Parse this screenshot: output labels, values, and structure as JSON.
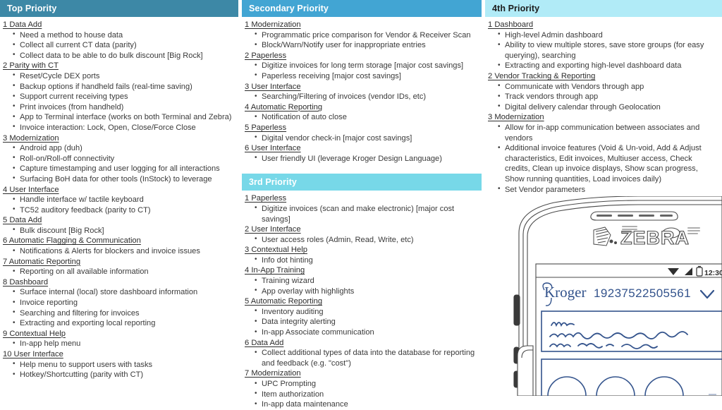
{
  "columns": [
    {
      "id": "top-priority",
      "sections": [
        {
          "band": {
            "label": "Top Priority",
            "bg": "#3d88a6",
            "text_color": "#ffffff"
          },
          "groups": [
            {
              "title": "1 Data Add",
              "items": [
                "Need a method to house data",
                "Collect all current CT data (parity)",
                "Collect data to be able to do bulk discount [Big Rock]"
              ]
            },
            {
              "title": "2 Parity with CT",
              "items": [
                "Reset/Cycle DEX ports",
                "Backup options if handheld fails (real-time saving)",
                "Support current receiving types",
                "Print invoices (from handheld)",
                "App to Terminal interface (works on both Terminal and Zebra)",
                "Invoice interaction: Lock, Open, Close/Force Close"
              ]
            },
            {
              "title": "3 Modernization",
              "items": [
                "Android app (duh)",
                "Roll-on/Roll-off connectivity",
                "Capture timestamping and user logging for all interactions",
                "Surfacing BoH data for other tools (InStock) to leverage"
              ]
            },
            {
              "title": "4 User Interface",
              "items": [
                "Handle interface w/ tactile keyboard",
                "TC52 auditory feedback (parity to CT)"
              ]
            },
            {
              "title": "5 Data Add",
              "items": [
                "Bulk discount [Big Rock]"
              ]
            },
            {
              "title": "6 Automatic Flagging & Communication",
              "items": [
                "Notifications & Alerts for blockers and invoice issues"
              ]
            },
            {
              "title": "7 Automatic Reporting",
              "items": [
                "Reporting on all available information"
              ]
            },
            {
              "title": "8 Dashboard",
              "items": [
                "Surface internal (local) store dashboard information",
                "Invoice reporting",
                "Searching and filtering for invoices",
                "Extracting and exporting local reporting"
              ]
            },
            {
              "title": "9 Contextual Help",
              "items": [
                "In-app help menu"
              ]
            },
            {
              "title": "10 User Interface",
              "items": [
                "Help menu to support users with tasks",
                "Hotkey/Shortcutting (parity with CT)"
              ]
            }
          ]
        }
      ]
    },
    {
      "id": "secondary-and-third-priority",
      "sections": [
        {
          "band": {
            "label": "Secondary Priority",
            "bg": "#42a5d3",
            "text_color": "#ffffff"
          },
          "groups": [
            {
              "title": "1 Modernization",
              "items": [
                "Programmatic price comparison for Vendor & Receiver Scan",
                "Block/Warn/Notify user for inappropriate entries"
              ]
            },
            {
              "title": "2 Paperless",
              "items": [
                "Digitize invoices for long term storage [major cost savings]",
                "Paperless receiving [major cost savings]"
              ]
            },
            {
              "title": "3 User Interface",
              "items": [
                "Searching/Filtering of invoices (vendor IDs, etc)"
              ]
            },
            {
              "title": "4 Automatic Reporting",
              "items": [
                "Notification of auto close"
              ]
            },
            {
              "title": "5 Paperless",
              "items": [
                "Digital vendor check-in [major cost savings]"
              ]
            },
            {
              "title": "6 User Interface",
              "items": [
                "User friendly UI (leverage Kroger Design Language)"
              ]
            }
          ]
        },
        {
          "band": {
            "label": "3rd Priority",
            "bg": "#77d8e8",
            "text_color": "#ffffff"
          },
          "groups": [
            {
              "title": "1 Paperless",
              "items": [
                "Digitize invoices (scan and make electronic) [major cost savings]"
              ]
            },
            {
              "title": "2 User Interface",
              "items": [
                "User access roles (Admin, Read, Write, etc)"
              ]
            },
            {
              "title": "3 Contextual Help",
              "items": [
                "Info dot hinting"
              ]
            },
            {
              "title": "4 In-App Training",
              "items": [
                "Training wizard",
                "App overlay with highlights"
              ]
            },
            {
              "title": "5 Automatic Reporting",
              "items": [
                "Inventory auditing",
                "Data integrity alerting",
                "In-app Associate communication"
              ]
            },
            {
              "title": "6 Data Add",
              "items": [
                "Collect additional types of data into the database for reporting and feedback (e.g. \"cost\")"
              ]
            },
            {
              "title": "7 Modernization",
              "items": [
                "UPC Prompting",
                "Item authorization",
                "In-app data maintenance"
              ]
            }
          ]
        }
      ]
    },
    {
      "id": "fourth-priority",
      "sections": [
        {
          "band": {
            "label": "4th Priority",
            "bg": "#b1ebf7",
            "text_color": "#1c1c1c"
          },
          "groups": [
            {
              "title": "1 Dashboard",
              "items": [
                "High-level Admin dashboard",
                "Ability to view multiple stores, save store groups (for easy querying), searching",
                "Extracting and exporting high-level dashboard data"
              ]
            },
            {
              "title": "2 Vendor Tracking & Reporting",
              "items": [
                "Communicate with Vendors through app",
                "Track vendors through app",
                "Digital delivery calendar through Geolocation"
              ]
            },
            {
              "title": "3 Modernization",
              "items": [
                "Allow for in-app communication between associates and vendors",
                "Additional invoice features (Void & Un-void, Add & Adjust characteristics, Edit invoices, Multiuser access, Check credits, Clean up invoice displays, Show scan progress, Show running quantities, Load invoices daily)",
                "Set Vendor parameters"
              ]
            }
          ]
        }
      ]
    }
  ],
  "device": {
    "brand_label": "ZEBRA",
    "app_brand": "Kroger",
    "invoice_number": "19237522505561",
    "status_time": "12:30",
    "icons": [
      "wifi-icon",
      "signal-icon",
      "battery-icon",
      "chevron-down-icon"
    ],
    "line_color": "#33538c",
    "outline_color": "#4a4a4a"
  }
}
